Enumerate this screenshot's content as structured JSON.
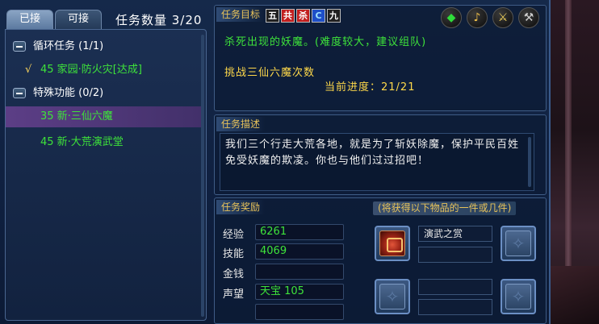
{
  "tabs": [
    {
      "label": "已接"
    },
    {
      "label": "可接"
    }
  ],
  "quest_count": "任务数量 3/20",
  "quest_list": {
    "group1": {
      "label": "循环任务 (1/1)"
    },
    "item1": {
      "check": "√",
      "label": "45 家园·防火灾[达成]"
    },
    "group2": {
      "label": "特殊功能 (0/2)"
    },
    "item2": {
      "label": "35 新·三仙六魔"
    },
    "item3": {
      "label": "45 新·大荒演武堂"
    }
  },
  "goal": {
    "title": "任务目标",
    "icons": [
      {
        "name": "five-icon",
        "glyph": "五"
      },
      {
        "name": "shared-icon",
        "glyph": "共"
      },
      {
        "name": "kill-icon",
        "glyph": "杀"
      },
      {
        "name": "repeat-icon",
        "glyph": "C"
      },
      {
        "name": "nine-icon",
        "glyph": "九"
      }
    ],
    "text": "杀死出现的妖魔。(难度较大，建议组队)",
    "challenge": "挑战三仙六魔次数",
    "progress": "当前进度：21/21"
  },
  "top_buttons": [
    {
      "name": "gem-icon",
      "glyph": "◆",
      "color": "#2fdc3a"
    },
    {
      "name": "speaker-icon",
      "glyph": "♪",
      "color": "#f2c14a"
    },
    {
      "name": "sword-icon",
      "glyph": "⚔",
      "color": "#f2d35a"
    },
    {
      "name": "hammer-icon",
      "glyph": "⚒",
      "color": "#d0d0d0"
    }
  ],
  "description": {
    "title": "任务描述",
    "text": "我们三个行走大荒各地，就是为了斩妖除魔，保护平民百姓免受妖魔的欺凌。你也与他们过过招吧！"
  },
  "reward": {
    "title": "任务奖励",
    "note": "(将获得以下物品的一件或几件)",
    "rows": [
      {
        "label": "经验",
        "value": "6261"
      },
      {
        "label": "技能",
        "value": "4069"
      },
      {
        "label": "金钱",
        "value": ""
      },
      {
        "label": "声望",
        "value": "天宝 105"
      },
      {
        "label": "",
        "value": ""
      }
    ],
    "item_name": "演武之赏"
  }
}
